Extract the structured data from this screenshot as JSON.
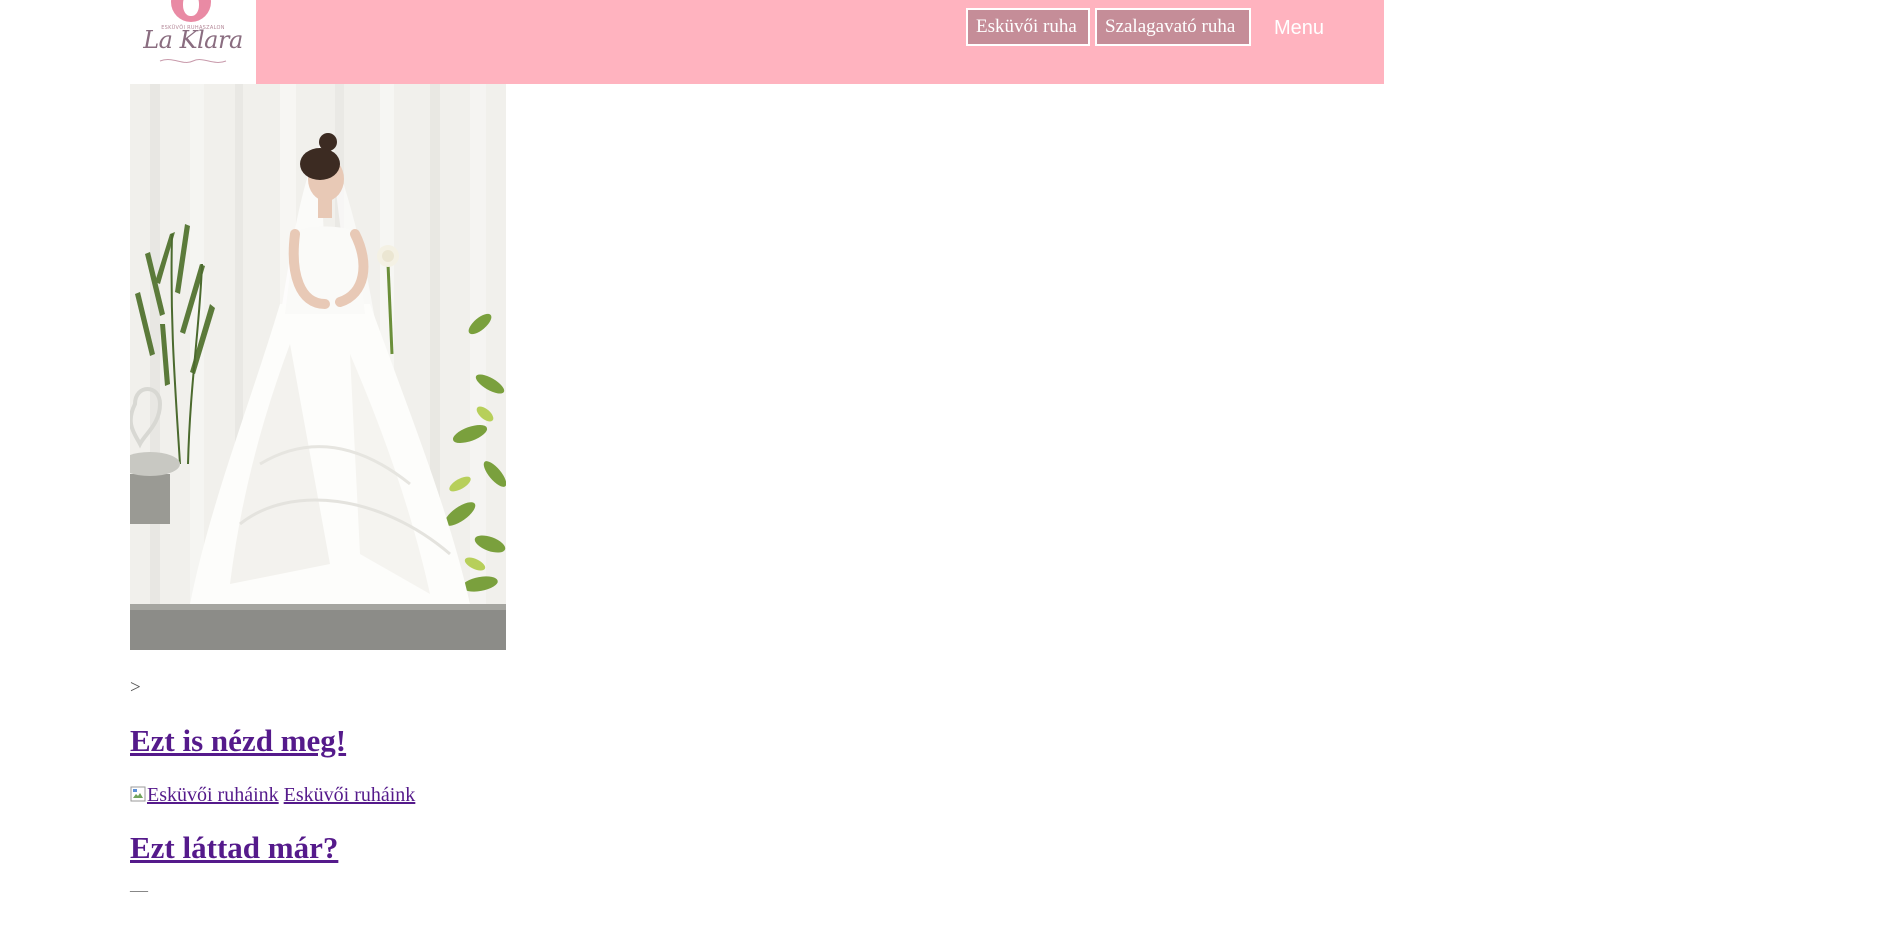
{
  "header": {
    "logo_text": "La Klara",
    "logo_small_text": "ESKÜVŐI RUHASZALON",
    "nav": {
      "wedding_dress_label": "Esküvői ruha",
      "prom_dress_label": "Szalagavató ruha",
      "menu_label": "Menu"
    },
    "colors": {
      "bar": "#ffb3bf",
      "button": "#c58d98"
    }
  },
  "hero": {
    "alt": "Menyasszony esküvői ruhában fehér rózsával"
  },
  "content": {
    "arrow": ">",
    "heading_see_also": "Ezt is nézd meg!",
    "image_alt": "Esküvői ruháink",
    "link_label": "Esküvői ruháink",
    "heading_seen": "Ezt láttad már?",
    "dash": "—",
    "link_color": "#551a8b"
  }
}
